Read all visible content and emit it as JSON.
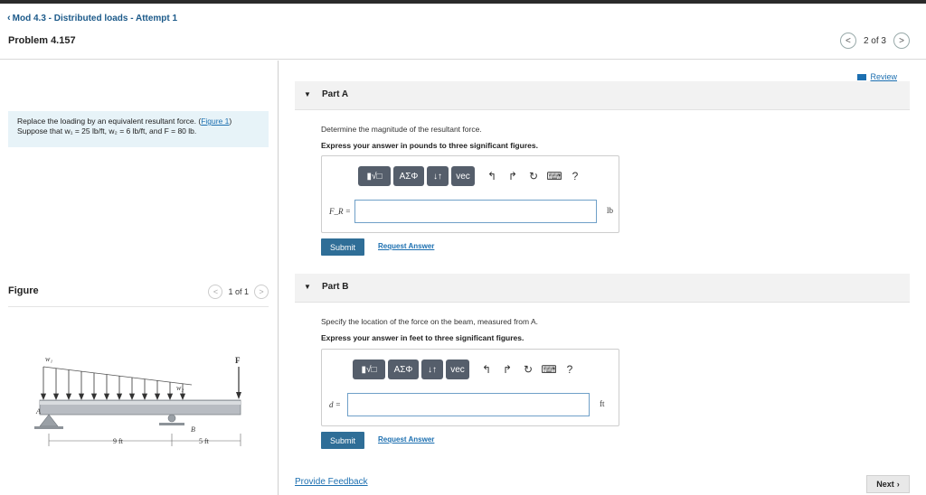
{
  "header": {
    "back_label": "Mod 4.3 - Distributed loads - Attempt 1",
    "problem_title": "Problem 4.157",
    "pager_text": "2 of 3"
  },
  "problem": {
    "text_1": "Replace the loading by an equivalent resultant force. (",
    "figure_link": "Figure 1",
    "text_2": ")",
    "text_3": "Suppose that w₁ = 25 lb/ft, w₂ = 6 lb/ft, and F = 80 lb."
  },
  "figure": {
    "title": "Figure",
    "pager_text": "1 of 1",
    "labels": {
      "w1": "w₁",
      "w2": "w₂",
      "F": "F",
      "A": "A",
      "B": "B",
      "dim1": "9 ft",
      "dim2": "5 ft"
    }
  },
  "review_label": "Review",
  "toolbar": {
    "templates": "▮√□",
    "greek": "AΣΦ",
    "arrows": "↓↑",
    "vec": "vec",
    "undo": "↰",
    "redo": "↱",
    "reset": "↻",
    "keyboard": "⌨",
    "help": "?"
  },
  "partA": {
    "title": "Part A",
    "question": "Determine the magnitude of the resultant force.",
    "instruction": "Express your answer in pounds to three significant figures.",
    "label": "F_R =",
    "value": "",
    "unit": "lb",
    "submit": "Submit",
    "request": "Request Answer"
  },
  "partB": {
    "title": "Part B",
    "question": "Specify the location of the force on the beam, measured from A.",
    "instruction": "Express your answer in feet to three significant figures.",
    "label": "d =",
    "value": "",
    "unit": "ft",
    "submit": "Submit",
    "request": "Request Answer"
  },
  "footer": {
    "feedback": "Provide Feedback",
    "next": "Next"
  }
}
